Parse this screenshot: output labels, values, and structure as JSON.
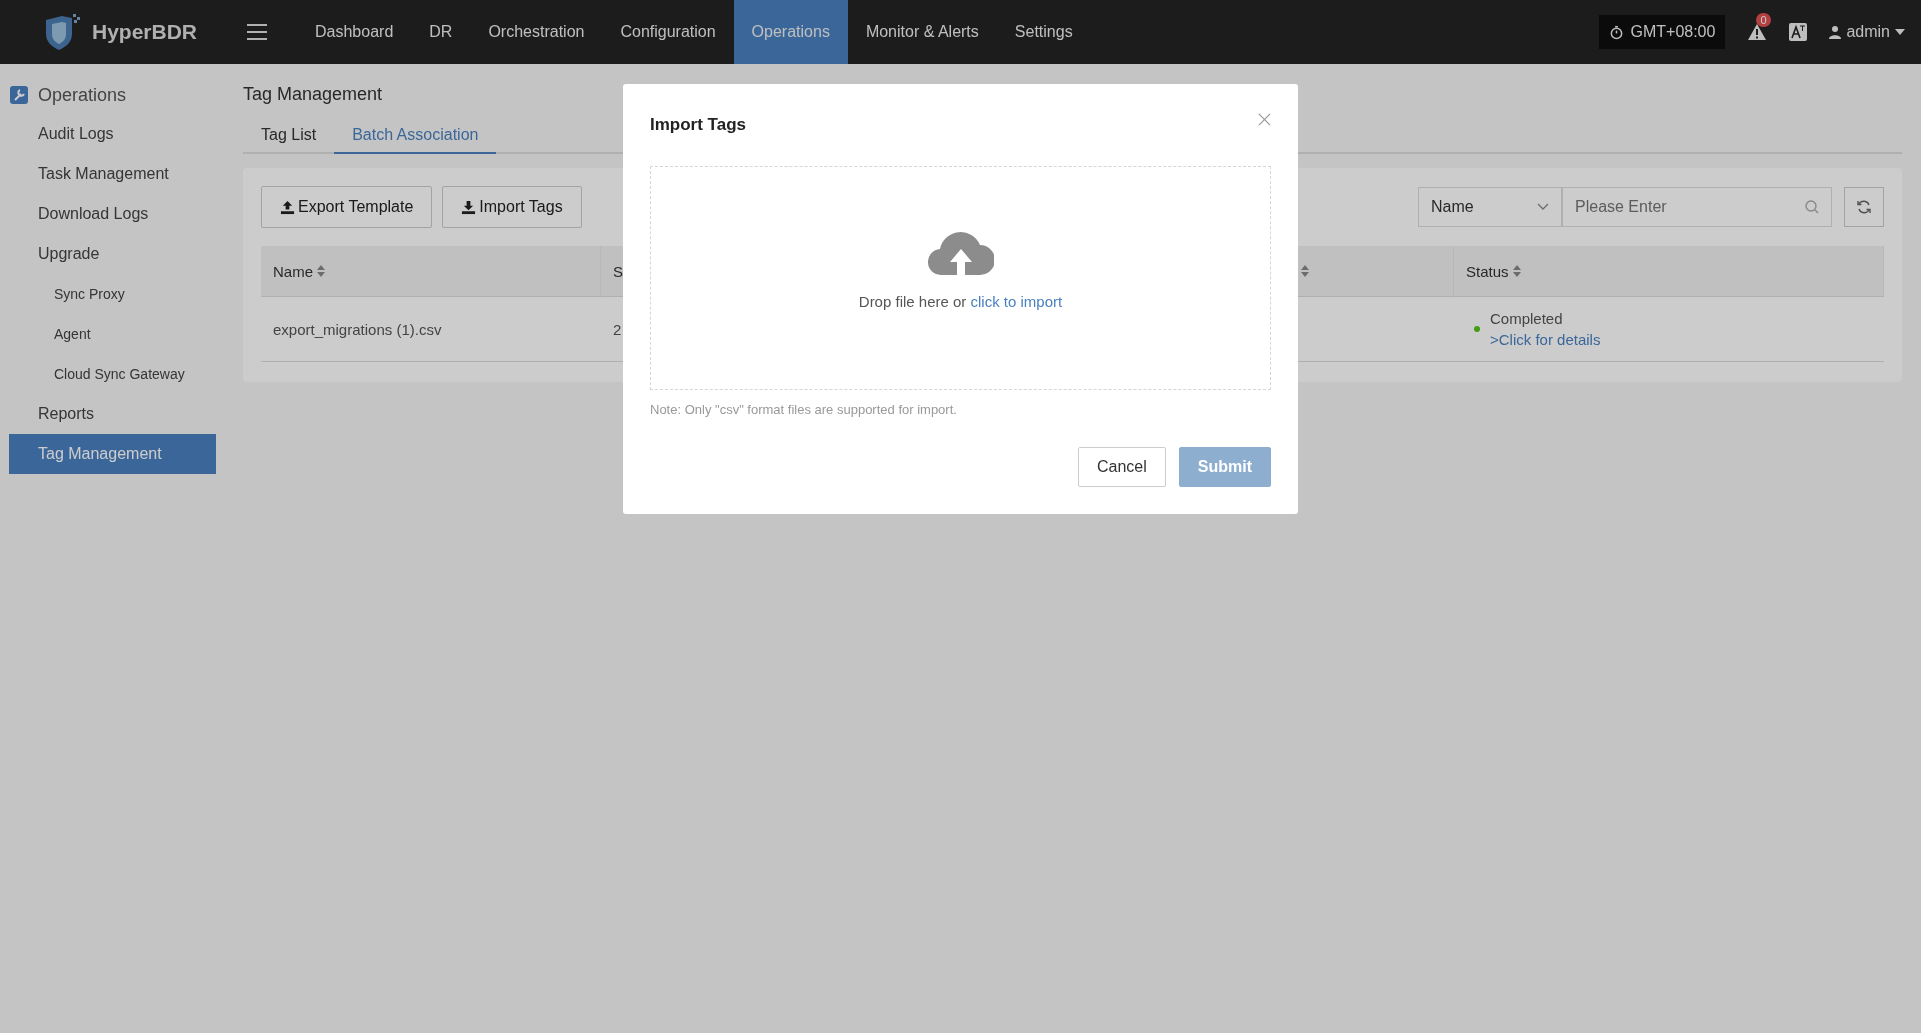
{
  "app": {
    "brand": "HyperBDR"
  },
  "nav": [
    {
      "label": "Dashboard",
      "selected": false
    },
    {
      "label": "DR",
      "selected": false
    },
    {
      "label": "Orchestration",
      "selected": false
    },
    {
      "label": "Configuration",
      "selected": false
    },
    {
      "label": "Operations",
      "selected": true
    },
    {
      "label": "Monitor & Alerts",
      "selected": false
    },
    {
      "label": "Settings",
      "selected": false
    }
  ],
  "timezone": "GMT+08:00",
  "alerts_badge": "0",
  "user": "admin",
  "sidebar": {
    "title": "Operations",
    "items": [
      {
        "label": "Audit Logs",
        "selected": false
      },
      {
        "label": "Task Management",
        "selected": false
      },
      {
        "label": "Download Logs",
        "selected": false
      },
      {
        "label": "Upgrade",
        "selected": false,
        "children": [
          {
            "label": "Sync Proxy",
            "selected": false
          },
          {
            "label": "Agent",
            "selected": false
          },
          {
            "label": "Cloud Sync Gateway",
            "selected": false
          }
        ]
      },
      {
        "label": "Reports",
        "selected": false
      },
      {
        "label": "Tag Management",
        "selected": true
      }
    ]
  },
  "page_title": "Tag Management",
  "tabs": [
    {
      "label": "Tag List",
      "selected": false
    },
    {
      "label": "Batch Association",
      "selected": true
    }
  ],
  "toolbar": {
    "buttons": [
      "Export Template",
      "Import Tags"
    ],
    "filter_field": "Name",
    "search": {
      "placeholder": "Please Enter"
    }
  },
  "table": {
    "columns": [
      {
        "label": "Name",
        "sortable": true
      },
      {
        "label": "S"
      },
      {
        "sortable": true
      },
      {
        "label": "Status",
        "sortable": true
      }
    ],
    "rows": [
      {
        "cells": [
          "export_migrations (1).csv",
          "2"
        ],
        "status": "Completed",
        "color": "#429d15",
        "details_link": ">Click for details"
      }
    ]
  },
  "modal": {
    "title": "Import Tags",
    "drop_text": "Drop file here or ",
    "drop_link": "click to import",
    "note": "Note: Only \"csv\" format files are supported for import.",
    "buttons": [
      {
        "label": "Cancel",
        "kind": "default",
        "disabled": false
      },
      {
        "label": "Submit",
        "kind": "primary",
        "disabled": true
      }
    ]
  }
}
